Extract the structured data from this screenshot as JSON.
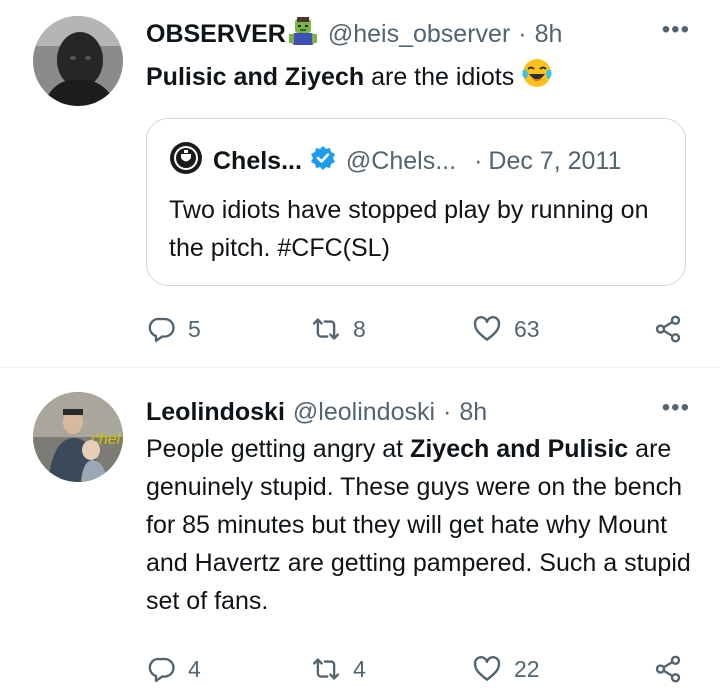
{
  "tweets": [
    {
      "author_name": "OBSERVER",
      "handle": "@heis_observer",
      "separator": "·",
      "time": "8h",
      "more": "•••",
      "text_bold_1": "Pulisic and Ziyech",
      "text_plain_1": " are the idiots ",
      "quote": {
        "author_name": "Chels...",
        "handle": "@Chels...",
        "separator": "·",
        "date": "Dec 7, 2011",
        "text": "Two idiots have stopped play by running on the pitch. #CFC(SL)"
      },
      "actions": {
        "reply": "5",
        "retweet": "8",
        "like": "63"
      }
    },
    {
      "author_name": "Leolindoski",
      "handle": "@leolindoski",
      "separator": "·",
      "time": "8h",
      "more": "•••",
      "text_plain_1": "People getting angry at ",
      "text_bold_1": "Ziyech and Pulisic",
      "text_plain_2": " are genuinely stupid. These guys were on the bench for 85 minutes but they will get hate why Mount and Havertz are getting pampered. Such a stupid set of fans.",
      "avatar_shirt_text": "chel",
      "actions": {
        "reply": "4",
        "retweet": "4",
        "like": "22"
      }
    }
  ],
  "colors": {
    "text": "#0f1419",
    "muted": "#536471",
    "verified": "#1d9bf0",
    "border": "#cfd9de"
  },
  "icons": [
    "zombie-emoji-icon",
    "laughing-tears-emoji-icon",
    "chelsea-crest-icon",
    "verified-badge-icon",
    "reply-icon",
    "retweet-icon",
    "like-icon",
    "share-icon",
    "more-icon"
  ]
}
